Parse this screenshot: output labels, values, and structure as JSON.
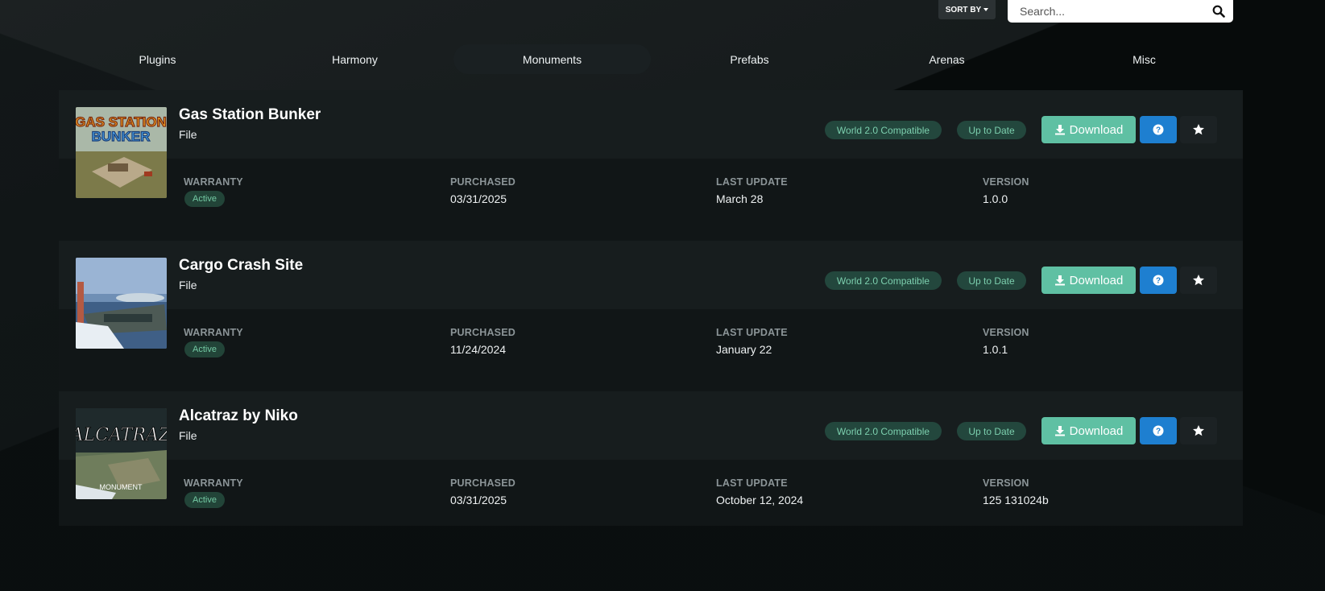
{
  "colors": {
    "page_bg": "#070b0b",
    "card_header_bg": "#171d1e",
    "card_body_bg": "#111617",
    "badge_bg": "#23473d",
    "badge_text": "#7ccfae",
    "download": "#5fc0a3",
    "help": "#1e7fd0"
  },
  "toolbar": {
    "sort_label": "SORT BY",
    "search_placeholder": "Search..."
  },
  "tabs": [
    {
      "label": "Plugins",
      "active": false
    },
    {
      "label": "Harmony",
      "active": false
    },
    {
      "label": "Monuments",
      "active": true
    },
    {
      "label": "Prefabs",
      "active": false
    },
    {
      "label": "Arenas",
      "active": false
    },
    {
      "label": "Misc",
      "active": false
    }
  ],
  "labels": {
    "warranty": "WARRANTY",
    "purchased": "PURCHASED",
    "last_update": "LAST UPDATE",
    "version": "VERSION",
    "compat_badge": "World 2.0 Compatible",
    "status_badge": "Up to Date",
    "download": "Download"
  },
  "items": [
    {
      "title": "Gas Station Bunker",
      "type": "File",
      "thumb_text": [
        "GAS STATION",
        "BUNKER"
      ],
      "warranty": "Active",
      "purchased": "03/31/2025",
      "last_update": "March 28",
      "version": "1.0.0"
    },
    {
      "title": "Cargo Crash Site",
      "type": "File",
      "thumb_text": [],
      "warranty": "Active",
      "purchased": "11/24/2024",
      "last_update": "January 22",
      "version": "1.0.1"
    },
    {
      "title": "Alcatraz by Niko",
      "type": "File",
      "thumb_text": [
        "ALCATRAZ",
        "MONUMENT"
      ],
      "warranty": "Active",
      "purchased": "03/31/2025",
      "last_update": "October 12, 2024",
      "version": "125 131024b"
    }
  ]
}
